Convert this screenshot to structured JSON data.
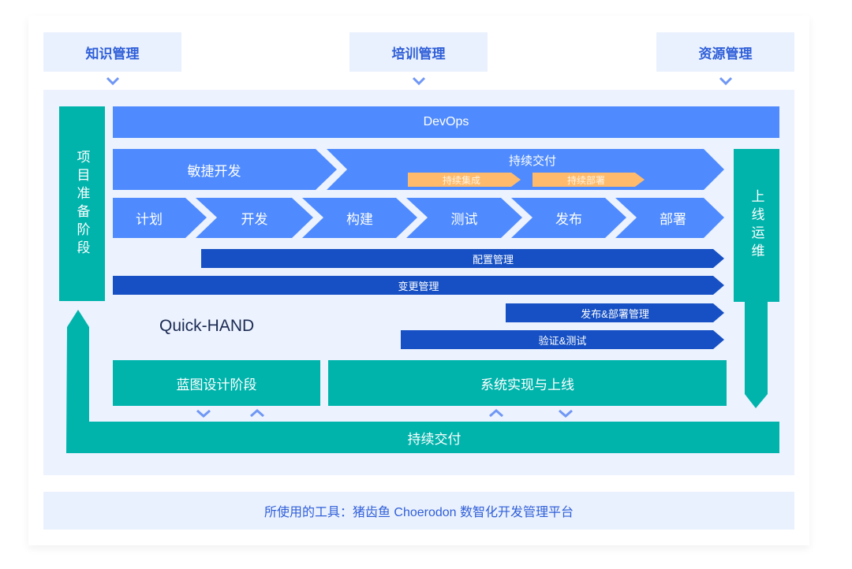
{
  "top_inputs": [
    {
      "label": "知识管理"
    },
    {
      "label": "培训管理"
    },
    {
      "label": "资源管理"
    }
  ],
  "devops": {
    "label": "DevOps"
  },
  "agile": {
    "label": "敏捷开发"
  },
  "continuous_delivery_top": {
    "label": "持续交付",
    "sub_items": [
      {
        "label": "持续集成"
      },
      {
        "label": "持续部署"
      }
    ]
  },
  "pipeline_steps": [
    {
      "label": "计划"
    },
    {
      "label": "开发"
    },
    {
      "label": "构建"
    },
    {
      "label": "测试"
    },
    {
      "label": "发布"
    },
    {
      "label": "部署"
    }
  ],
  "management_bars": [
    {
      "label": "配置管理"
    },
    {
      "label": "变更管理"
    },
    {
      "label": "发布&部署管理"
    },
    {
      "label": "验证&测试"
    }
  ],
  "left_phase": {
    "label": "项目准备阶段"
  },
  "right_phase": {
    "label": "上线运维"
  },
  "brand": {
    "label": "Quick-HAND"
  },
  "blueprint_phase": {
    "label": "蓝图设计阶段"
  },
  "implementation_phase": {
    "label": "系统实现与上线"
  },
  "continuous_delivery_bottom": {
    "label": "持续交付"
  },
  "footer": {
    "label": "所使用的工具：猪齿鱼 Choerodon 数智化开发管理平台"
  },
  "colors": {
    "light_blue": "#4f8bfe",
    "dark_blue": "#1650c4",
    "teal": "#00b4ac",
    "orange": "#ffbb6b",
    "panel_bg": "#ecf2fe",
    "label_blue": "#2f5fd8"
  }
}
